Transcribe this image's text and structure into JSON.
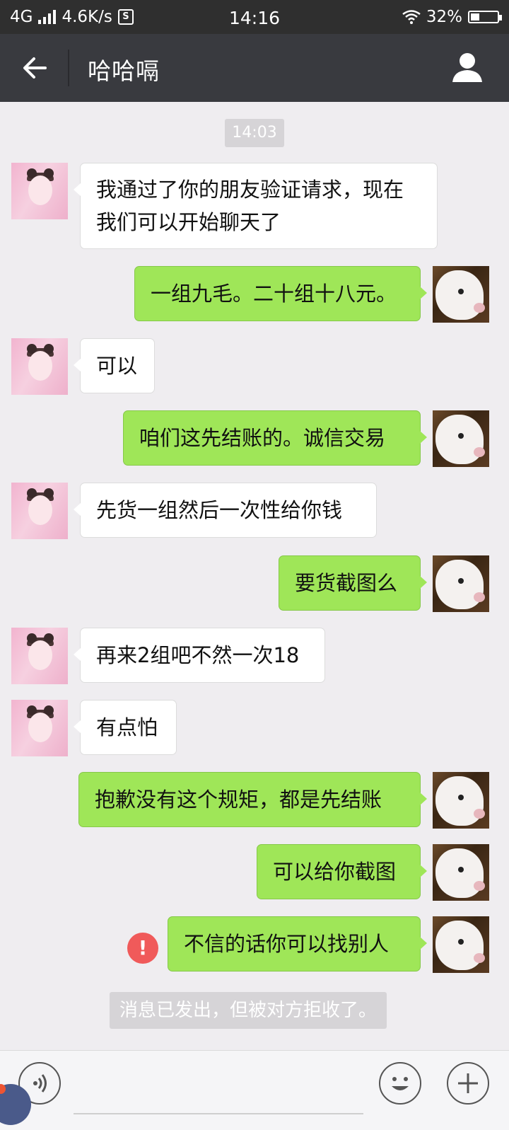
{
  "status_bar": {
    "network": "4G",
    "speed": "4.6K/s",
    "s_badge": "S",
    "time": "14:16",
    "battery": "32%",
    "battery_level": 0.32
  },
  "header": {
    "back_icon": "arrow-left-icon",
    "title": "哈哈嗝",
    "profile_icon": "person-icon"
  },
  "chat": {
    "timestamp": "14:03",
    "messages": [
      {
        "side": "left",
        "text_line1": "我通过了你的朋友验证请求，现在",
        "text_line2": "我们可以开始聊天了"
      },
      {
        "side": "right",
        "text": "一组九毛。二十组十八元。"
      },
      {
        "side": "left",
        "text": "可以"
      },
      {
        "side": "right",
        "text": "咱们这先结账的。诚信交易"
      },
      {
        "side": "left",
        "text": "先货一组然后一次性给你钱"
      },
      {
        "side": "right",
        "text": "要货截图么"
      },
      {
        "side": "left",
        "text": "再来2组吧不然一次18"
      },
      {
        "side": "left",
        "text": "有点怕"
      },
      {
        "side": "right",
        "text": "抱歉没有这个规矩，都是先结账"
      },
      {
        "side": "right",
        "text": "可以给你截图"
      },
      {
        "side": "right",
        "text": "不信的话你可以找别人",
        "failed": true
      }
    ],
    "error_mark": "!",
    "system_note": "消息已发出，但被对方拒收了。"
  },
  "input_bar": {
    "voice_icon": "voice-icon",
    "emoji_icon": "emoji-icon",
    "plus_icon": "plus-icon"
  },
  "colors": {
    "title_bar": "#393a3f",
    "status_bar": "#2f2f2f",
    "background": "#efedf0",
    "sent_bubble": "#9fe658",
    "received_bubble": "#ffffff",
    "error": "#f05a5a"
  }
}
